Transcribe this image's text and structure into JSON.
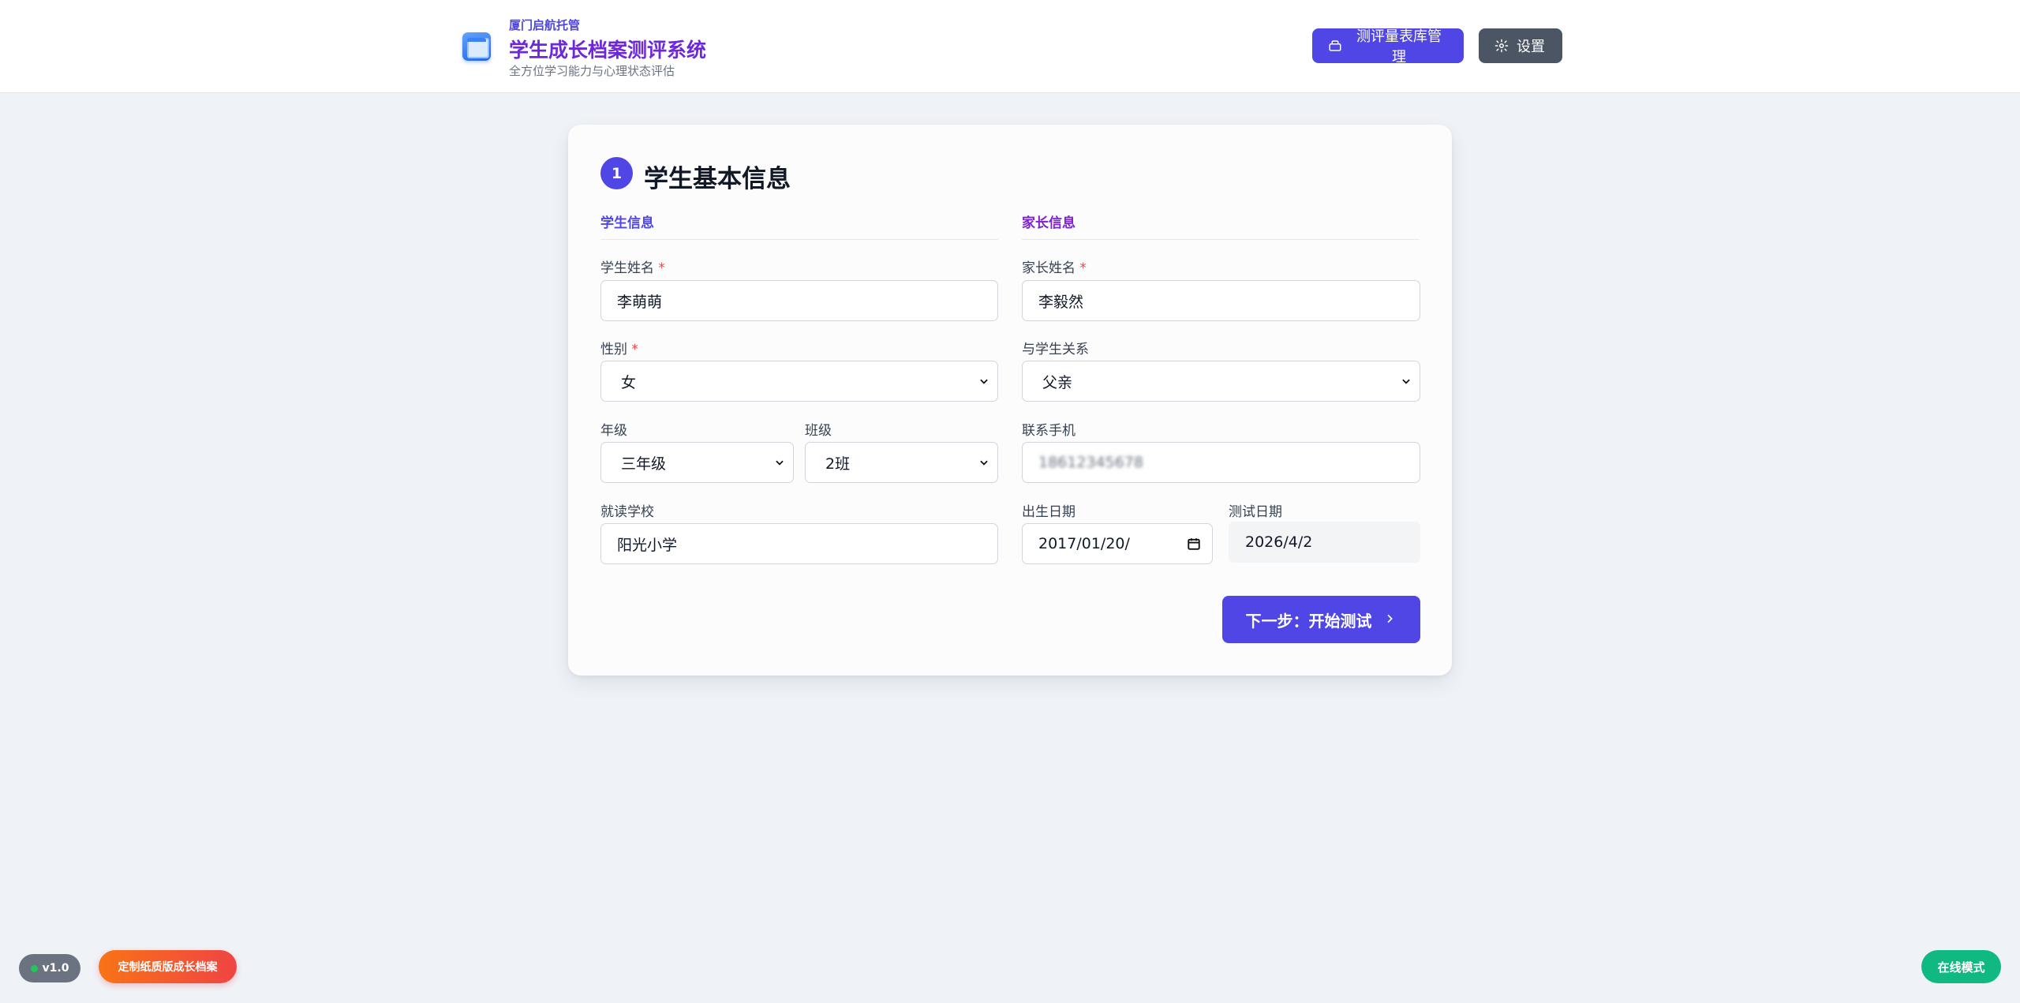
{
  "header": {
    "org": "厦门启航托管",
    "title": "学生成长档案测评系统",
    "subtitle": "全方位学习能力与心理状态评估",
    "scale_button": "测评量表库管理",
    "settings_button": "设置"
  },
  "card": {
    "step_number": "1",
    "title": "学生基本信息",
    "student_section": "学生信息",
    "parent_section": "家长信息",
    "required_mark": "*",
    "fields": {
      "student_name": {
        "label": "学生姓名",
        "value": "李萌萌"
      },
      "gender": {
        "label": "性别",
        "value": "女"
      },
      "grade": {
        "label": "年级",
        "value": "三年级"
      },
      "class": {
        "label": "班级",
        "value": "2班"
      },
      "school": {
        "label": "就读学校",
        "value": "阳光小学"
      },
      "parent_name": {
        "label": "家长姓名",
        "value": "李毅然"
      },
      "relation": {
        "label": "与学生关系",
        "value": "父亲"
      },
      "phone": {
        "label": "联系手机",
        "value": "18612345678"
      },
      "birth_date": {
        "label": "出生日期",
        "value": "2017/01/20/"
      },
      "test_date": {
        "label": "测试日期",
        "value": "2026/4/2"
      }
    },
    "next_button": "下一步：开始测试"
  },
  "footer": {
    "version": "v1.0",
    "print_badge": "定制纸质版成长档案",
    "mode_badge": "在线模式"
  },
  "colors": {
    "primary": "#4f46e5",
    "parent_accent": "#7e22ce",
    "online": "#10b981"
  }
}
